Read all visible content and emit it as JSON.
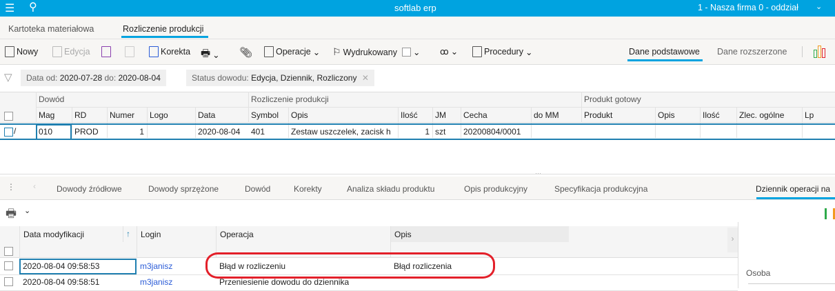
{
  "app": {
    "title": "softlab erp",
    "company": "1 - Nasza firma 0 - oddział"
  },
  "main_tabs": [
    {
      "label": "Kartoteka materiałowa"
    },
    {
      "label": "Rozliczenie produkcji",
      "active": true
    }
  ],
  "toolbar": {
    "new": "Nowy",
    "edit": "Edycja",
    "correction": "Korekta",
    "operations": "Operacje",
    "printed": "Wydrukowany",
    "procedures": "Procedury",
    "basic_data": "Dane podstawowe",
    "extended_data": "Dane rozszerzone"
  },
  "filters": {
    "date_label": "Data",
    "from_label": "od:",
    "from": "2020-07-28",
    "to_label": "do:",
    "to": "2020-08-04",
    "status_label": "Status dowodu:",
    "status": "Edycja, Dziennik, Rozliczony"
  },
  "grid": {
    "groups": [
      "Dowód",
      "Rozliczenie produkcji",
      "Produkt gotowy"
    ],
    "columns": [
      "Mag",
      "RD",
      "Numer",
      "Logo",
      "Data",
      "Symbol",
      "Opis",
      "Ilość",
      "JM",
      "Cecha",
      "do MM",
      "Produkt",
      "Opis",
      "Ilość",
      "Zlec. ogólne",
      "Lp"
    ],
    "rows": [
      [
        "010",
        "PROD",
        "1",
        "",
        "2020-08-04",
        "401",
        "Zestaw uszczelek, zacisk h",
        "1",
        "szt",
        "20200804/0001",
        "",
        "",
        "",
        "",
        "",
        ""
      ]
    ]
  },
  "detail_tabs": [
    "Dowody źródłowe",
    "Dowody sprzężone",
    "Dowód",
    "Korekty",
    "Analiza składu produktu",
    "Opis produkcyjny",
    "Specyfikacja produkcyjna",
    "Dziennik operacji na"
  ],
  "log": {
    "columns": [
      "Data modyfikacji",
      "Login",
      "Operacja",
      "Opis"
    ],
    "rows": [
      [
        "2020-08-04 09:58:53",
        "m3janisz",
        "Błąd w rozliczeniu",
        "Błąd rozliczenia"
      ],
      [
        "2020-08-04 09:58:51",
        "m3janisz",
        "Przeniesienie dowodu do dziennika",
        ""
      ]
    ]
  },
  "side_panel": {
    "person_label": "Osoba"
  },
  "colors": {
    "accent": "#00a3e0",
    "highlight": "#e3202a",
    "link": "#2a5bd7"
  }
}
